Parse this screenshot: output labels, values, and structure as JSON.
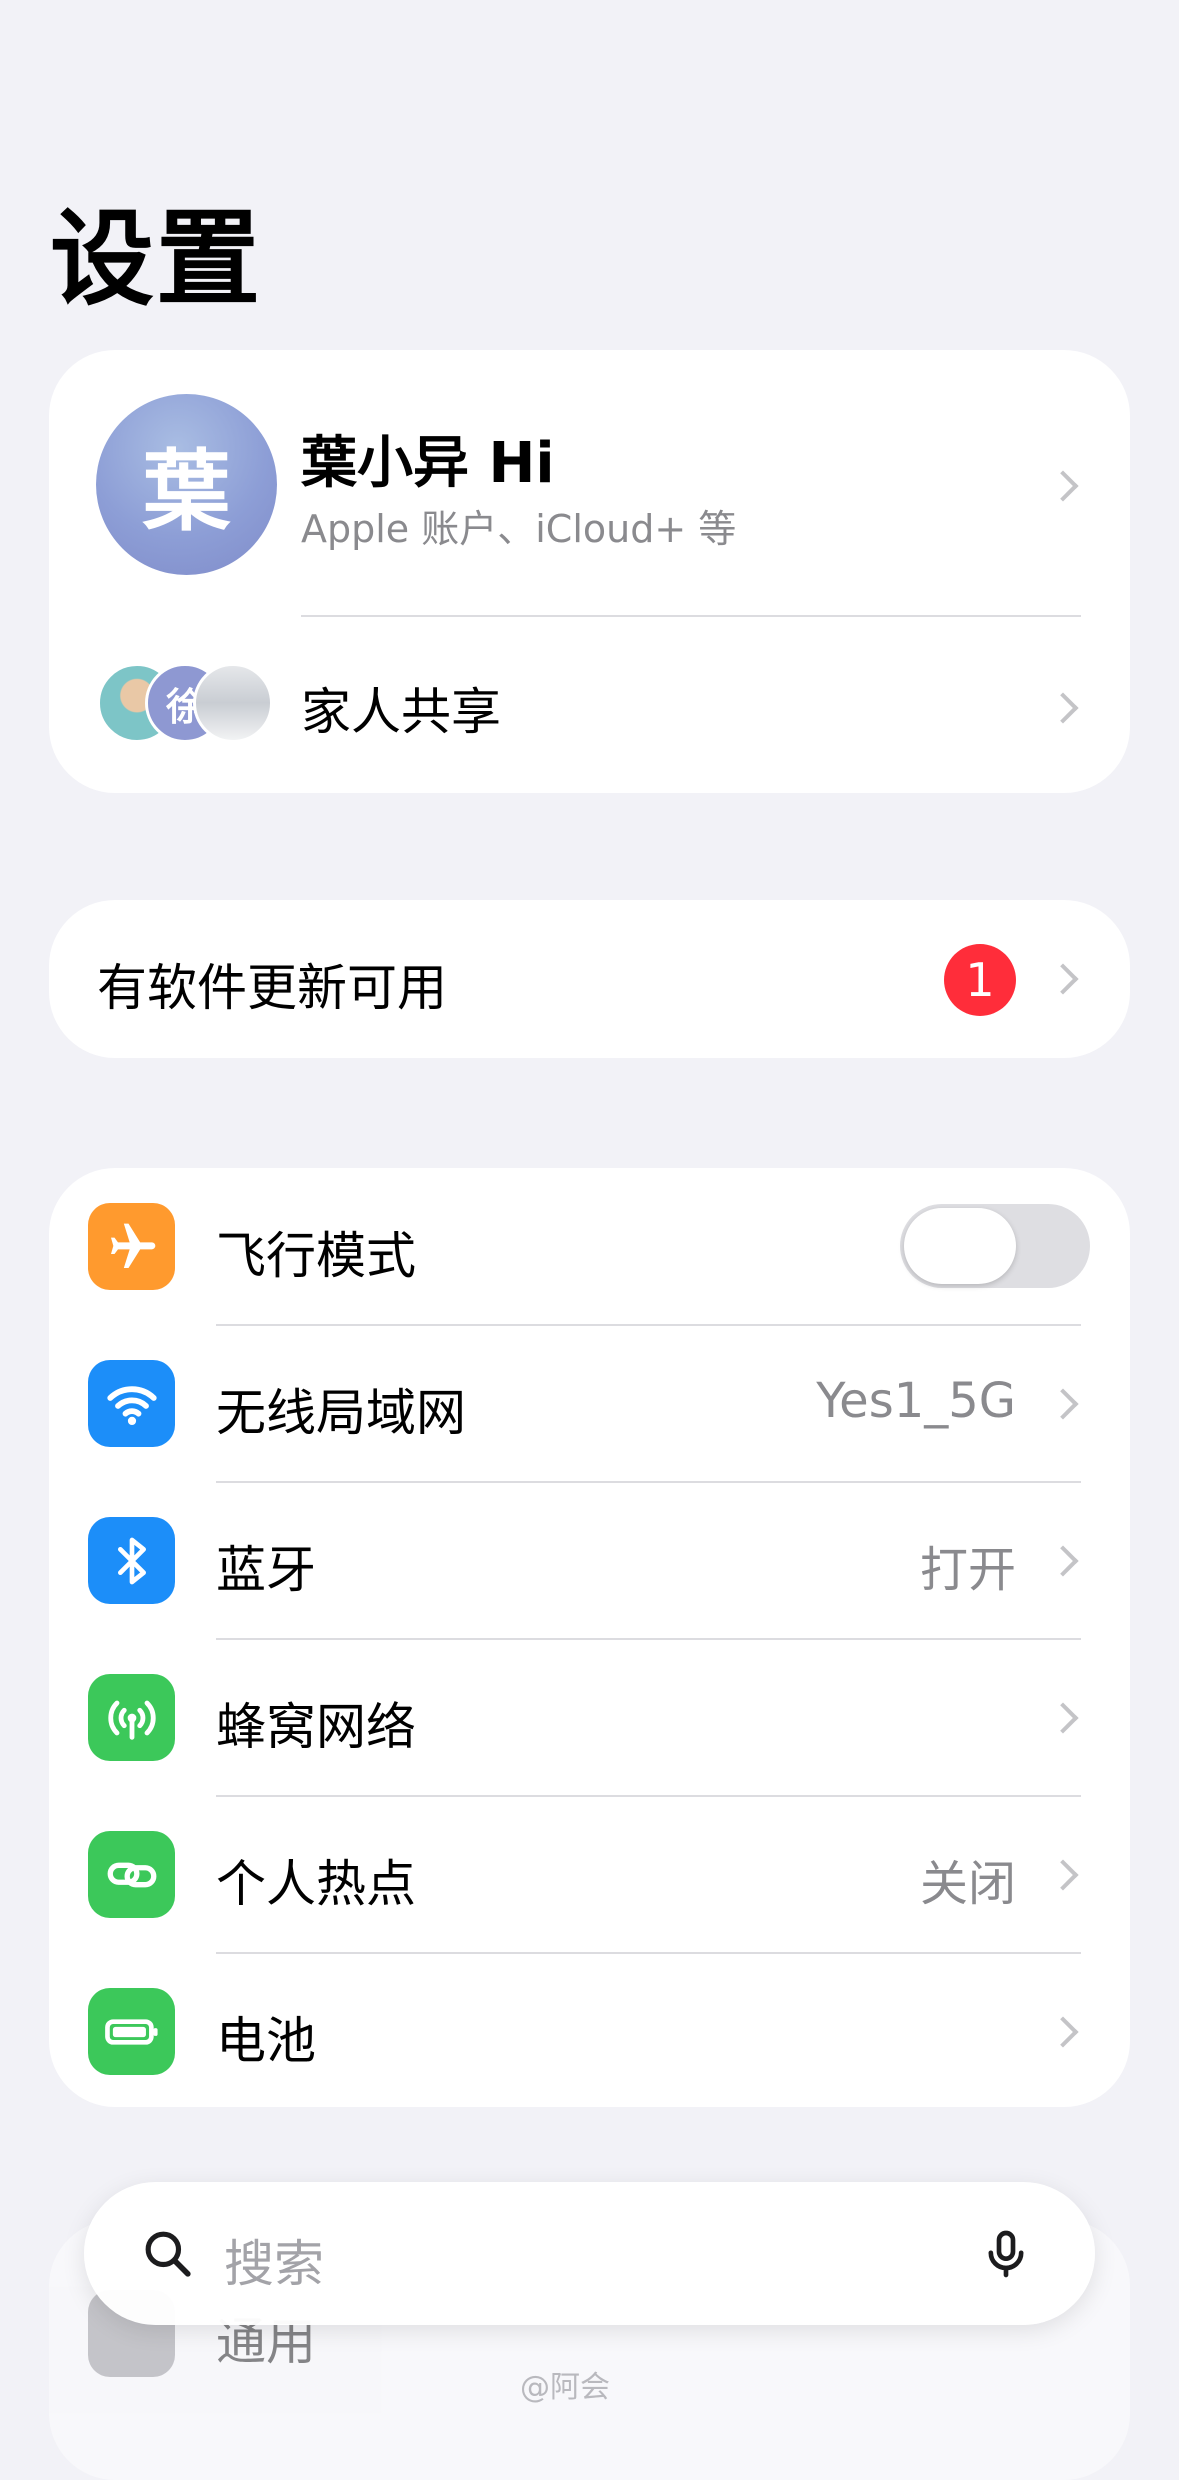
{
  "title": "设置",
  "profile": {
    "avatar_text": "葉",
    "name": "葉小异 Hi",
    "subtitle": "Apple 账户、iCloud+ 等",
    "family_avatar_text": "徐",
    "family_label": "家人共享"
  },
  "update": {
    "label": "有软件更新可用",
    "badge": "1"
  },
  "settings": [
    {
      "label": "飞行模式",
      "icon": "airplane-icon",
      "color": "#ff9a2e",
      "toggle_on": false
    },
    {
      "label": "无线局域网",
      "icon": "wifi-icon",
      "color": "#1c8ef9",
      "value": "Yes1_5G"
    },
    {
      "label": "蓝牙",
      "icon": "bluetooth-icon",
      "color": "#1c8ef9",
      "value": "打开"
    },
    {
      "label": "蜂窝网络",
      "icon": "cellular-icon",
      "color": "#3cc85a",
      "value": ""
    },
    {
      "label": "个人热点",
      "icon": "hotspot-icon",
      "color": "#3cc85a",
      "value": "关闭"
    },
    {
      "label": "电池",
      "icon": "battery-icon",
      "color": "#3cc85a",
      "value": ""
    }
  ],
  "partial_row_label": "通用",
  "search": {
    "placeholder": "搜索"
  },
  "watermark": "@阿会"
}
